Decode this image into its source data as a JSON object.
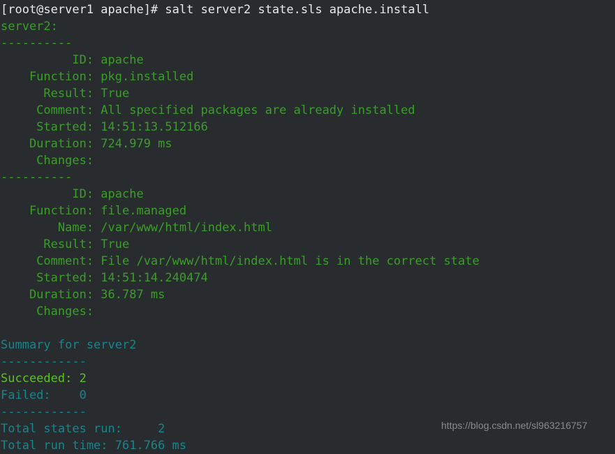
{
  "terminal": {
    "background_color": "#282c2f",
    "colors": {
      "command_text": "#e8e9ea",
      "output_green": "#3a9e28",
      "succeeded_green": "#5fbf1f",
      "summary_cyan": "#17858c",
      "watermark_grey": "#8d9093"
    },
    "prompt": "[root@server1 apache]#",
    "command": "salt server2 state.sls apache.install",
    "lines": [
      {
        "text": "[root@server1 apache]# salt server2 state.sls apache.install",
        "color": "white"
      },
      {
        "text": "server2:",
        "color": "green"
      },
      {
        "text": "----------",
        "color": "green"
      },
      {
        "text": "          ID: apache",
        "color": "green"
      },
      {
        "text": "    Function: pkg.installed",
        "color": "green"
      },
      {
        "text": "      Result: True",
        "color": "green"
      },
      {
        "text": "     Comment: All specified packages are already installed",
        "color": "green"
      },
      {
        "text": "     Started: 14:51:13.512166",
        "color": "green"
      },
      {
        "text": "    Duration: 724.979 ms",
        "color": "green"
      },
      {
        "text": "     Changes:",
        "color": "green"
      },
      {
        "text": "----------",
        "color": "green"
      },
      {
        "text": "          ID: apache",
        "color": "green"
      },
      {
        "text": "    Function: file.managed",
        "color": "green"
      },
      {
        "text": "        Name: /var/www/html/index.html",
        "color": "green"
      },
      {
        "text": "      Result: True",
        "color": "green"
      },
      {
        "text": "     Comment: File /var/www/html/index.html is in the correct state",
        "color": "green"
      },
      {
        "text": "     Started: 14:51:14.240474",
        "color": "green"
      },
      {
        "text": "    Duration: 36.787 ms",
        "color": "green"
      },
      {
        "text": "     Changes:",
        "color": "green"
      },
      {
        "text": " ",
        "color": "blank"
      },
      {
        "text": "Summary for server2",
        "color": "cyan"
      },
      {
        "text": "------------",
        "color": "cyan"
      },
      {
        "text": "Succeeded: 2",
        "color": "lgreen"
      },
      {
        "text": "Failed:    0",
        "color": "cyan"
      },
      {
        "text": "------------",
        "color": "cyan"
      },
      {
        "text": "Total states run:     2",
        "color": "cyan"
      },
      {
        "text": "Total run time: 761.766 ms",
        "color": "cyan"
      }
    ],
    "states": [
      {
        "id": "apache",
        "function": "pkg.installed",
        "name": "",
        "result": "True",
        "comment": "All specified packages are already installed",
        "started": "14:51:13.512166",
        "duration": "724.979 ms",
        "changes": ""
      },
      {
        "id": "apache",
        "function": "file.managed",
        "name": "/var/www/html/index.html",
        "result": "True",
        "comment": "File /var/www/html/index.html is in the correct state",
        "started": "14:51:14.240474",
        "duration": "36.787 ms",
        "changes": ""
      }
    ],
    "summary": {
      "heading": "Summary for server2",
      "minion": "server2",
      "succeeded_label": "Succeeded:",
      "succeeded": "2",
      "failed_label": "Failed:",
      "failed": "0",
      "total_states_label": "Total states run:",
      "total_states": "2",
      "total_run_time_label": "Total run time:",
      "total_run_time": "761.766 ms"
    }
  },
  "watermark": {
    "text": "https://blog.csdn.net/sl963216757"
  }
}
